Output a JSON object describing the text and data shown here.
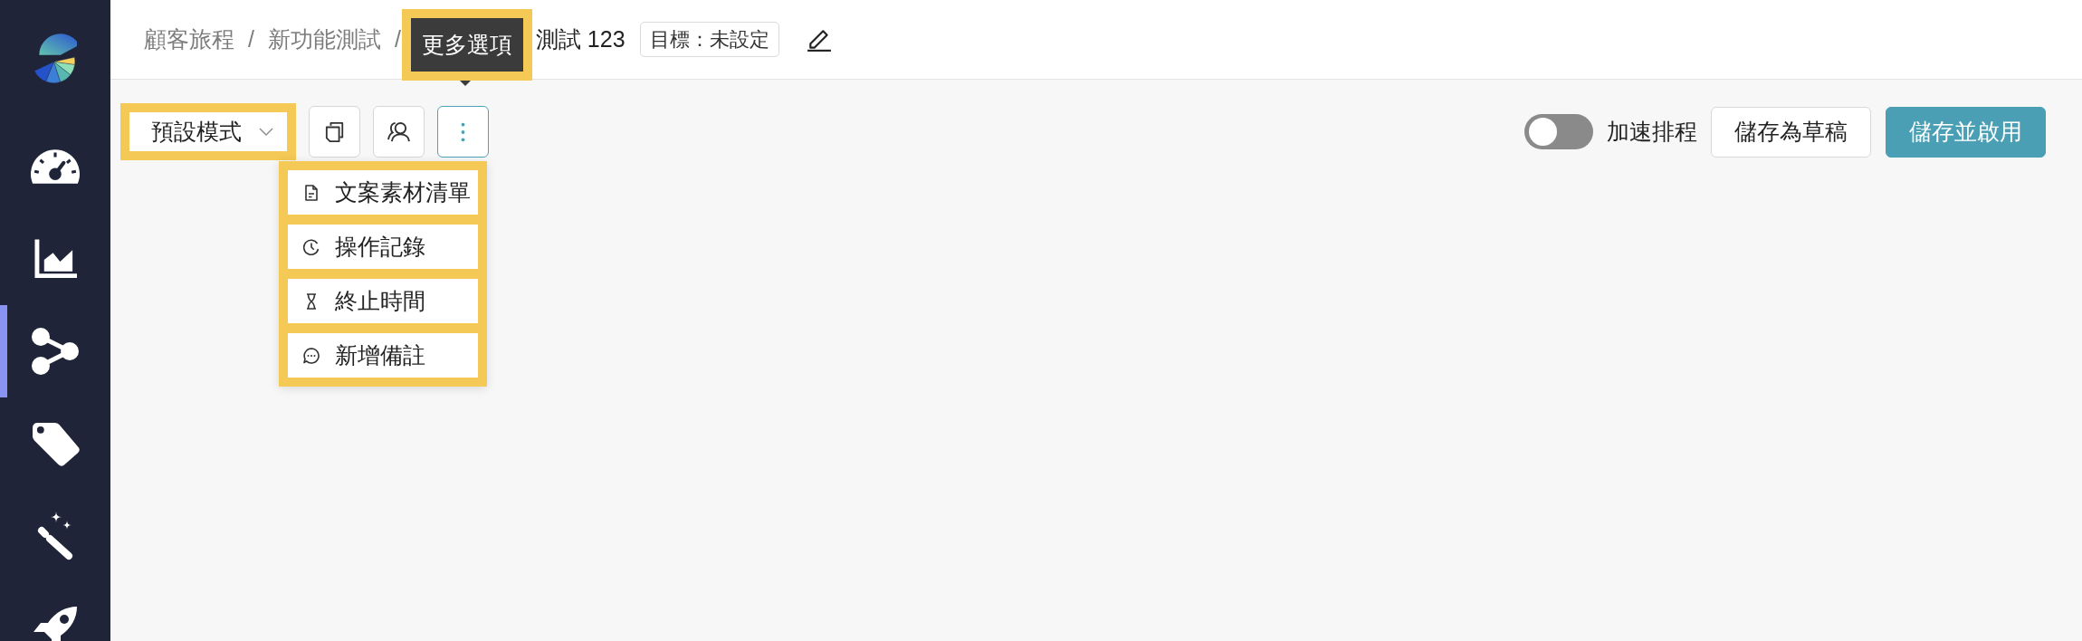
{
  "sidebar": {
    "items": [
      {
        "selected": false
      },
      {
        "selected": false
      },
      {
        "selected": true
      },
      {
        "selected": false
      },
      {
        "selected": false
      },
      {
        "selected": false
      }
    ]
  },
  "breadcrumb": [
    {
      "label": "顧客旅程",
      "separator": "/"
    },
    {
      "label": "新功能測試",
      "separator": "/"
    },
    {
      "label": "測試 123"
    }
  ],
  "goal_badge": "目標：未設定",
  "tooltip": {
    "text": "更多選項",
    "highlighted": true
  },
  "toolbar": {
    "mode_dropdown": {
      "value": "預設模式",
      "highlighted": true
    },
    "icon_buttons": [
      {
        "active": false
      },
      {
        "active": false
      },
      {
        "active": true
      }
    ],
    "fast_schedule": {
      "label": "加速排程",
      "on": false
    },
    "buttons": [
      {
        "label": "儲存為草稿",
        "kind": "secondary"
      },
      {
        "label": "儲存並啟用",
        "kind": "primary"
      }
    ]
  },
  "more_menu": {
    "highlighted": true,
    "items": [
      {
        "label": "文案素材清單"
      },
      {
        "label": "操作記錄"
      },
      {
        "label": "終止時間"
      },
      {
        "label": "新增備註"
      }
    ]
  }
}
